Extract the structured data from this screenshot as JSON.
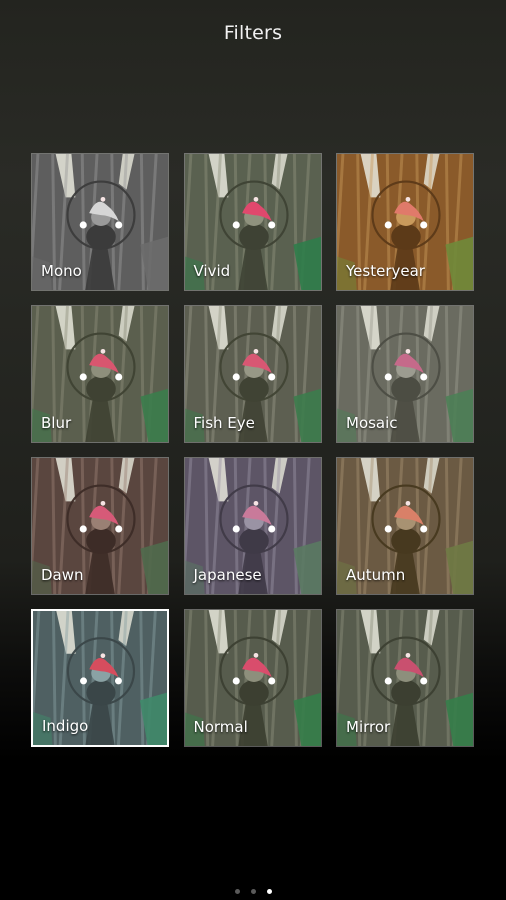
{
  "header": {
    "title": "Filters"
  },
  "filters": [
    {
      "label": "Mono",
      "bg": "#5e5e5e",
      "mid": "#9a9a9a",
      "trunk": "#3b3b3b",
      "ground": "#6b6b6b",
      "hat": "#d6d6d6",
      "selected": false
    },
    {
      "label": "Vivid",
      "bg": "#5a6150",
      "mid": "#8f927e",
      "trunk": "#3e4234",
      "ground": "#2f7d4a",
      "hat": "#e0486d",
      "selected": false
    },
    {
      "label": "Yesteryear",
      "bg": "#8a5a2a",
      "mid": "#c99a5c",
      "trunk": "#5c3a18",
      "ground": "#6f8a3a",
      "hat": "#e07a6a",
      "selected": false
    },
    {
      "label": "Blur",
      "bg": "#5b5f4e",
      "mid": "#8e8f7c",
      "trunk": "#3f4233",
      "ground": "#3b7d4c",
      "hat": "#d8566f",
      "selected": false
    },
    {
      "label": "Fish Eye",
      "bg": "#5d5f51",
      "mid": "#979886",
      "trunk": "#404334",
      "ground": "#3c7c4c",
      "hat": "#d85773",
      "selected": false
    },
    {
      "label": "Mosaic",
      "bg": "#6a6b60",
      "mid": "#9c9c90",
      "trunk": "#4c4d43",
      "ground": "#4d7f57",
      "hat": "#c56a8a",
      "selected": false
    },
    {
      "label": "Dawn",
      "bg": "#5a463f",
      "mid": "#9a8074",
      "trunk": "#3d2c27",
      "ground": "#4f6a4d",
      "hat": "#d65a78",
      "selected": false
    },
    {
      "label": "Japanese",
      "bg": "#5d5566",
      "mid": "#9a93a4",
      "trunk": "#3f3a47",
      "ground": "#5a7a62",
      "hat": "#c97a9a",
      "selected": false
    },
    {
      "label": "Autumn",
      "bg": "#6b5a43",
      "mid": "#a89272",
      "trunk": "#47391f",
      "ground": "#6f7a45",
      "hat": "#d98068",
      "selected": false
    },
    {
      "label": "Indigo",
      "bg": "#4f6062",
      "mid": "#8aa2a4",
      "trunk": "#3a4648",
      "ground": "#3f8a6a",
      "hat": "#d64d5e",
      "selected": true
    },
    {
      "label": "Normal",
      "bg": "#575c4d",
      "mid": "#8d8f7c",
      "trunk": "#3c3f31",
      "ground": "#357e4a",
      "hat": "#d94d6c",
      "selected": false
    },
    {
      "label": "Mirror",
      "bg": "#575c4d",
      "mid": "#8d8f7c",
      "trunk": "#3c3f31",
      "ground": "#357e4a",
      "hat": "#c9506f",
      "selected": false
    }
  ],
  "pager": {
    "count": 3,
    "active": 2
  }
}
